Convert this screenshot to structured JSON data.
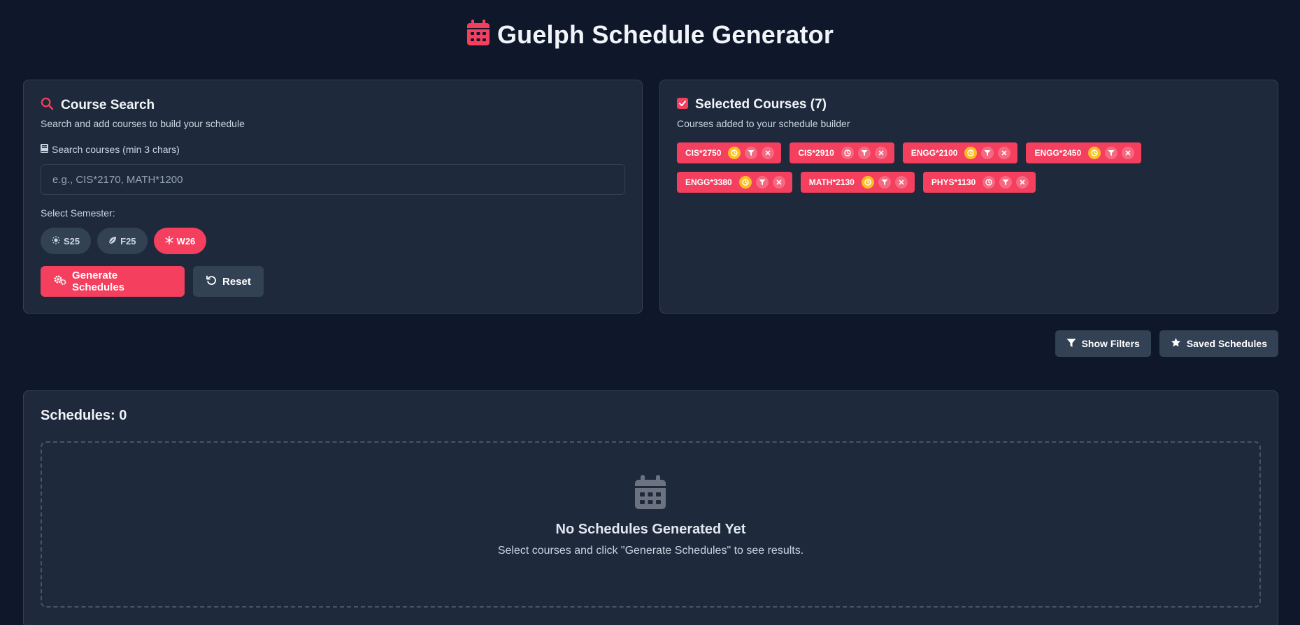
{
  "header": {
    "title": "Guelph Schedule Generator",
    "icon": "calendar-icon"
  },
  "search_panel": {
    "title": "Course Search",
    "subtitle": "Search and add courses to build your schedule",
    "search_label": "Search courses (min 3 chars)",
    "search_placeholder": "e.g., CIS*2170, MATH*1200",
    "search_value": "",
    "semester_label": "Select Semester:",
    "semesters": [
      {
        "label": "S25",
        "icon": "sun-icon",
        "active": false
      },
      {
        "label": "F25",
        "icon": "leaf-icon",
        "active": false
      },
      {
        "label": "W26",
        "icon": "snowflake-icon",
        "active": true
      }
    ],
    "generate_label": "Generate Schedules",
    "reset_label": "Reset"
  },
  "selected_panel": {
    "title": "Selected Courses (7)",
    "subtitle": "Courses added to your schedule builder",
    "courses": [
      {
        "code": "CIS*2750",
        "time_warning": true
      },
      {
        "code": "CIS*2910",
        "time_warning": false
      },
      {
        "code": "ENGG*2100",
        "time_warning": true
      },
      {
        "code": "ENGG*2450",
        "time_warning": true
      },
      {
        "code": "ENGG*3380",
        "time_warning": true
      },
      {
        "code": "MATH*2130",
        "time_warning": true
      },
      {
        "code": "PHYS*1130",
        "time_warning": false
      }
    ]
  },
  "toolbar": {
    "show_filters_label": "Show Filters",
    "saved_schedules_label": "Saved Schedules"
  },
  "schedules": {
    "title": "Schedules: 0",
    "empty_title": "No Schedules Generated Yet",
    "empty_message": "Select courses and click \"Generate Schedules\" to see results."
  },
  "colors": {
    "background": "#0f172a",
    "card": "#1e293b",
    "accent": "#f43f5e",
    "warning": "#fbbf24",
    "secondary": "#334155"
  }
}
